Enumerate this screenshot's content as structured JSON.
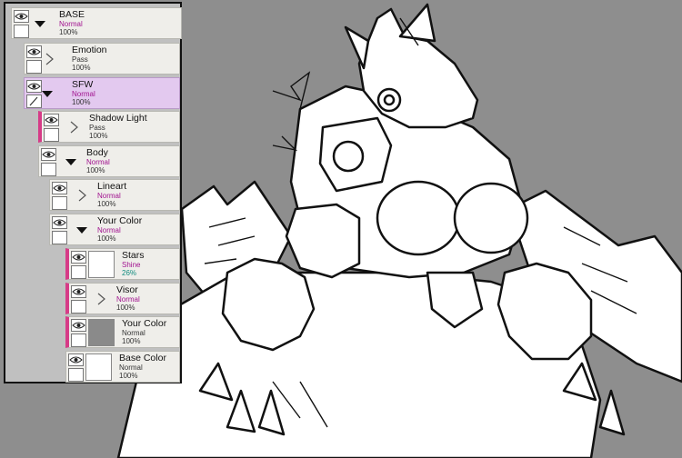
{
  "app": {
    "accent_selected": "#e3c9ef",
    "clip_marker": "#d63b87",
    "canvas_bg": "#8e8e8e"
  },
  "layers": [
    {
      "name": "BASE",
      "mode": "Normal",
      "opacity": "100%",
      "kind": "folder",
      "state": "expanded"
    },
    {
      "name": "Emotion",
      "mode": "Pass",
      "opacity": "100%",
      "kind": "folder",
      "state": "collapsed"
    },
    {
      "name": "SFW",
      "mode": "Normal",
      "opacity": "100%",
      "kind": "folder",
      "state": "expanded",
      "selected": true
    },
    {
      "name": "Shadow Light",
      "mode": "Pass",
      "opacity": "100%",
      "kind": "folder",
      "state": "collapsed"
    },
    {
      "name": "Body",
      "mode": "Normal",
      "opacity": "100%",
      "kind": "folder",
      "state": "expanded"
    },
    {
      "name": "Lineart",
      "mode": "Normal",
      "opacity": "100%",
      "kind": "folder",
      "state": "collapsed"
    },
    {
      "name": "Your Color",
      "mode": "Normal",
      "opacity": "100%",
      "kind": "folder",
      "state": "expanded"
    },
    {
      "name": "Stars",
      "mode": "Shine",
      "opacity": "26%",
      "kind": "layer"
    },
    {
      "name": "Visor",
      "mode": "Normal",
      "opacity": "100%",
      "kind": "folder",
      "state": "collapsed"
    },
    {
      "name": "Your Color",
      "mode": "Normal",
      "opacity": "100%",
      "kind": "layer"
    },
    {
      "name": "Base Color",
      "mode": "Normal",
      "opacity": "100%",
      "kind": "layer"
    }
  ]
}
